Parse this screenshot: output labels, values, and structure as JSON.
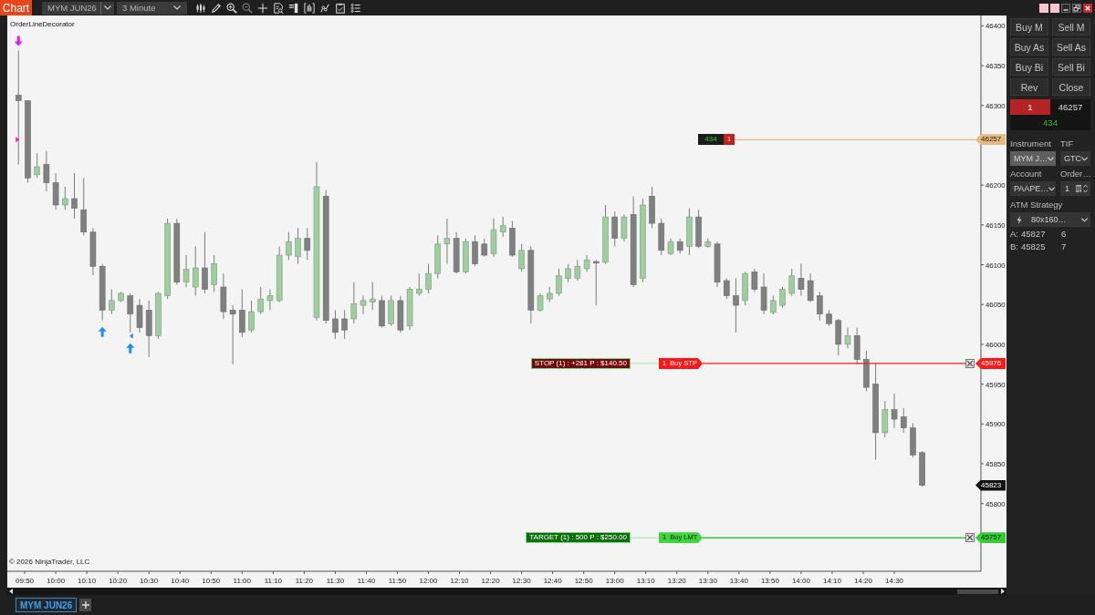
{
  "toolbar": {
    "title": "Chart",
    "instrument": "MYM JUN26",
    "interval": "3 Minute"
  },
  "chart": {
    "indicator_label": "OrderLineDecorator",
    "copyright": "© 2026 NinjaTrader, LLC",
    "last_price": "45823",
    "order_lines": [
      {
        "kind": "position",
        "pnl": "434",
        "quantity": "1"
      },
      {
        "kind": "stop",
        "summary": "STOP (1) : +281 P : $140.50",
        "quantity": "1",
        "order_type": "Buy STP"
      },
      {
        "kind": "target",
        "summary": "TARGET (1) : 500 P : $250.00",
        "quantity": "1",
        "order_type": "Buy LMT"
      }
    ],
    "chart_data": [
      {
        "type": "candlestick",
        "x": [
          9.8,
          9.85,
          9.9,
          9.95,
          10,
          10.05,
          10.1,
          10.15,
          10.2,
          10.25,
          10.3,
          10.35,
          10.4,
          10.45,
          10.5,
          10.55,
          10.6,
          10.65,
          10.7,
          10.75,
          10.8,
          10.85,
          10.9,
          10.95,
          11,
          11.05,
          11.1,
          11.15,
          11.2,
          11.25,
          11.3,
          11.35,
          11.4,
          11.45,
          11.5,
          11.55,
          11.6,
          11.65,
          11.7,
          11.75,
          11.8,
          11.85,
          11.9,
          11.95,
          12,
          12.05,
          12.1,
          12.15,
          12.2,
          12.25,
          12.3,
          12.35,
          12.4,
          12.45,
          12.5,
          12.55,
          12.6,
          12.65,
          12.7,
          12.75,
          12.8,
          12.85,
          12.9,
          12.95,
          13,
          13.05,
          13.1,
          13.15,
          13.2,
          13.25,
          13.3,
          13.35,
          13.4,
          13.45,
          13.5,
          13.55,
          13.6,
          13.65,
          13.7,
          13.75,
          13.8,
          13.85,
          13.9,
          13.95,
          14,
          14.05,
          14.1,
          14.15,
          14.2,
          14.25,
          14.3,
          14.35,
          14.4,
          14.45,
          14.5,
          14.55,
          14.6,
          14.65
        ],
        "ohlc": [
          [
            46313,
            46369,
            46226,
            46306
          ],
          [
            46306,
            46306,
            46203,
            46209
          ],
          [
            46213,
            46240,
            46209,
            46223
          ],
          [
            46226,
            46243,
            46192,
            46203
          ],
          [
            46203,
            46215,
            46169,
            46175
          ],
          [
            46175,
            46198,
            46169,
            46183
          ],
          [
            46183,
            46215,
            46158,
            46171
          ],
          [
            46169,
            46209,
            46137,
            46141
          ],
          [
            46141,
            46146,
            46087,
            46098
          ],
          [
            46098,
            46101,
            46030,
            46043
          ],
          [
            46043,
            46069,
            46038,
            46055
          ],
          [
            46055,
            46066,
            46053,
            46064
          ],
          [
            46061,
            46064,
            46015,
            46038
          ],
          [
            46049,
            46057,
            46015,
            46021
          ],
          [
            46043,
            46055,
            45984,
            46011
          ],
          [
            46011,
            46066,
            46007,
            46064
          ],
          [
            46061,
            46158,
            46057,
            46152
          ],
          [
            46152,
            46158,
            46075,
            46078
          ],
          [
            46078,
            46112,
            46072,
            46094
          ],
          [
            46072,
            46123,
            46061,
            46096
          ],
          [
            46096,
            46141,
            46064,
            46069
          ],
          [
            46075,
            46112,
            46066,
            46101
          ],
          [
            46072,
            46089,
            46032,
            46041
          ],
          [
            46043,
            46049,
            45975,
            46038
          ],
          [
            46043,
            46069,
            46009,
            46015
          ],
          [
            46018,
            46055,
            46015,
            46041
          ],
          [
            46041,
            46072,
            46038,
            46057
          ],
          [
            46055,
            46069,
            46043,
            46061
          ],
          [
            46055,
            46123,
            46053,
            46112
          ],
          [
            46112,
            46141,
            46106,
            46129
          ],
          [
            46110,
            46146,
            46101,
            46133
          ],
          [
            46133,
            46146,
            46106,
            46118
          ],
          [
            46034,
            46229,
            46030,
            46198
          ],
          [
            46186,
            46194,
            46026,
            46030
          ],
          [
            46032,
            46043,
            46007,
            46015
          ],
          [
            46032,
            46043,
            46007,
            46018
          ],
          [
            46032,
            46078,
            46026,
            46051
          ],
          [
            46049,
            46061,
            46038,
            46055
          ],
          [
            46053,
            46078,
            46043,
            46057
          ],
          [
            46055,
            46061,
            46021,
            46023
          ],
          [
            46026,
            46061,
            46023,
            46055
          ],
          [
            46055,
            46061,
            46015,
            46018
          ],
          [
            46023,
            46072,
            46018,
            46069
          ],
          [
            46064,
            46089,
            46061,
            46069
          ],
          [
            46069,
            46101,
            46064,
            46089
          ],
          [
            46089,
            46137,
            46083,
            46126
          ],
          [
            46126,
            46158,
            46101,
            46133
          ],
          [
            46133,
            46141,
            46089,
            46091
          ],
          [
            46091,
            46133,
            46089,
            46129
          ],
          [
            46129,
            46137,
            46098,
            46101
          ],
          [
            46126,
            46133,
            46110,
            46112
          ],
          [
            46114,
            46158,
            46110,
            46144
          ],
          [
            46141,
            46160,
            46135,
            46149
          ],
          [
            46146,
            46155,
            46110,
            46112
          ],
          [
            46095,
            46126,
            46091,
            46118
          ],
          [
            46118,
            46123,
            46026,
            46043
          ],
          [
            46043,
            46064,
            46041,
            46061
          ],
          [
            46057,
            46072,
            46053,
            46064
          ],
          [
            46064,
            46095,
            46061,
            46086
          ],
          [
            46083,
            46101,
            46078,
            46095
          ],
          [
            46083,
            46106,
            46080,
            46098
          ],
          [
            46095,
            46112,
            46091,
            46106
          ],
          [
            46104,
            46106,
            46049,
            46102
          ],
          [
            46103,
            46175,
            46101,
            46160
          ],
          [
            46160,
            46167,
            46123,
            46133
          ],
          [
            46133,
            46163,
            46129,
            46160
          ],
          [
            46163,
            46186,
            46072,
            46075
          ],
          [
            46083,
            46183,
            46078,
            46175
          ],
          [
            46186,
            46198,
            46146,
            46152
          ],
          [
            46152,
            46158,
            46112,
            46118
          ],
          [
            46114,
            46133,
            46112,
            46129
          ],
          [
            46129,
            46133,
            46114,
            46118
          ],
          [
            46123,
            46171,
            46112,
            46160
          ],
          [
            46160,
            46169,
            46121,
            46123
          ],
          [
            46123,
            46133,
            46121,
            46129
          ],
          [
            46126,
            46129,
            46072,
            46078
          ],
          [
            46080,
            46083,
            46057,
            46061
          ],
          [
            46061,
            46083,
            46015,
            46049
          ],
          [
            46055,
            46091,
            46049,
            46089
          ],
          [
            46091,
            46095,
            46066,
            46069
          ],
          [
            46072,
            46089,
            46038,
            46043
          ],
          [
            46040,
            46061,
            46038,
            46055
          ],
          [
            46049,
            46072,
            46046,
            46069
          ],
          [
            46064,
            46095,
            46061,
            46086
          ],
          [
            46083,
            46101,
            46061,
            46069
          ],
          [
            46080,
            46089,
            46053,
            46055
          ],
          [
            46061,
            46066,
            46030,
            46038
          ],
          [
            46038,
            46043,
            46023,
            46026
          ],
          [
            46030,
            46032,
            45986,
            46000
          ],
          [
            46000,
            46021,
            45995,
            46011
          ],
          [
            46011,
            46021,
            45975,
            45981
          ],
          [
            45981,
            45992,
            45941,
            45946
          ],
          [
            45950,
            45977,
            45855,
            45889
          ],
          [
            45889,
            45929,
            45883,
            45918
          ],
          [
            45918,
            45938,
            45895,
            45906
          ],
          [
            45909,
            45920,
            45889,
            45895
          ],
          [
            45895,
            45901,
            45858,
            45861
          ],
          [
            45864,
            45866,
            45821,
            45823
          ]
        ],
        "xlim": [
          9.74,
          14.965
        ],
        "ylim": [
          45715,
          46413
        ],
        "xticks": [
          {
            "value": 9.8333,
            "label": "09:50"
          },
          {
            "value": 10,
            "label": "10:00"
          },
          {
            "value": 10.1667,
            "label": "10:10"
          },
          {
            "value": 10.3333,
            "label": "10:20"
          },
          {
            "value": 10.5,
            "label": "10:30"
          },
          {
            "value": 10.6667,
            "label": "10:40"
          },
          {
            "value": 10.8333,
            "label": "10:50"
          },
          {
            "value": 11,
            "label": "11:00"
          },
          {
            "value": 11.1667,
            "label": "11:10"
          },
          {
            "value": 11.3333,
            "label": "11:20"
          },
          {
            "value": 11.5,
            "label": "11:30"
          },
          {
            "value": 11.6667,
            "label": "11:40"
          },
          {
            "value": 11.8333,
            "label": "11:50"
          },
          {
            "value": 12,
            "label": "12:00"
          },
          {
            "value": 12.1667,
            "label": "12:10"
          },
          {
            "value": 12.3333,
            "label": "12:20"
          },
          {
            "value": 12.5,
            "label": "12:30"
          },
          {
            "value": 12.6667,
            "label": "12:40"
          },
          {
            "value": 12.8333,
            "label": "12:50"
          },
          {
            "value": 13,
            "label": "13:00"
          },
          {
            "value": 13.1667,
            "label": "13:10"
          },
          {
            "value": 13.3333,
            "label": "13:20"
          },
          {
            "value": 13.5,
            "label": "13:30"
          },
          {
            "value": 13.6667,
            "label": "13:40"
          },
          {
            "value": 13.8333,
            "label": "13:50"
          },
          {
            "value": 14,
            "label": "14:00"
          },
          {
            "value": 14.1667,
            "label": "14:10"
          },
          {
            "value": 14.3333,
            "label": "14:20"
          },
          {
            "value": 14.5,
            "label": "14:30"
          }
        ],
        "yticks": [
          45800,
          45850,
          45900,
          45950,
          46000,
          46050,
          46100,
          46150,
          46200,
          46300,
          46350,
          46400
        ],
        "ref_lines": [
          {
            "axis": "y",
            "value": 46257,
            "label": "46257",
            "color": "#e6b97f"
          },
          {
            "axis": "y",
            "value": 45976,
            "label": "45976",
            "color": "#ff1a1a"
          },
          {
            "axis": "y",
            "value": 45757,
            "label": "45757",
            "color": "#33cc33"
          }
        ]
      }
    ]
  },
  "chart_trader": {
    "buttons": [
      "Buy M",
      "Sell M",
      "Buy As",
      "Sell As",
      "Buy Bi",
      "Sell Bi",
      "Rev",
      "Close"
    ],
    "position": {
      "quantity": "1",
      "price": "46257",
      "pnl": "434"
    },
    "instrument": {
      "label": "Instrument",
      "value": "MYM J…",
      "disabled": true
    },
    "tif": {
      "label": "TIF",
      "value": "GTC"
    },
    "account": {
      "label": "Account",
      "value": "PAAPE…"
    },
    "order_qty": {
      "label": "Order…",
      "value": "1"
    },
    "atm_strategy": {
      "label": "ATM Strategy",
      "value": "80x160…"
    },
    "quotes": [
      {
        "side": "A:",
        "price": "45827",
        "size": "6"
      },
      {
        "side": "B:",
        "price": "45825",
        "size": "7"
      }
    ]
  },
  "tabs": [
    {
      "label": "MYM JUN26",
      "selected": true
    }
  ]
}
